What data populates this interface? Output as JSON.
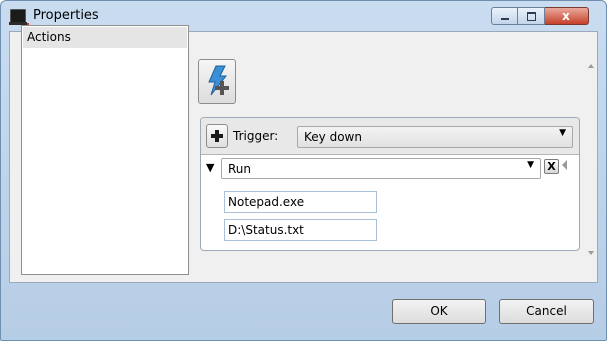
{
  "window": {
    "title": "Properties",
    "close_glyph": "x"
  },
  "sidebar": {
    "items": [
      {
        "label": "Actions"
      }
    ]
  },
  "panel": {
    "trigger_label": "Trigger:",
    "trigger_value": "Key down",
    "action_value": "Run",
    "delete_glyph": "X",
    "params": [
      "Notepad.exe",
      "D:\\Status.txt"
    ]
  },
  "footer": {
    "ok_label": "OK",
    "cancel_label": "Cancel"
  },
  "colors": {
    "titlebar": "#c9dcf0",
    "close_button": "#c6412b"
  },
  "icons": [
    "app-icon",
    "minimize-icon",
    "maximize-icon",
    "close-icon",
    "add-action-icon",
    "plus-icon",
    "expand-icon",
    "dropdown-arrow-icon",
    "delete-icon",
    "collapse-icon"
  ]
}
